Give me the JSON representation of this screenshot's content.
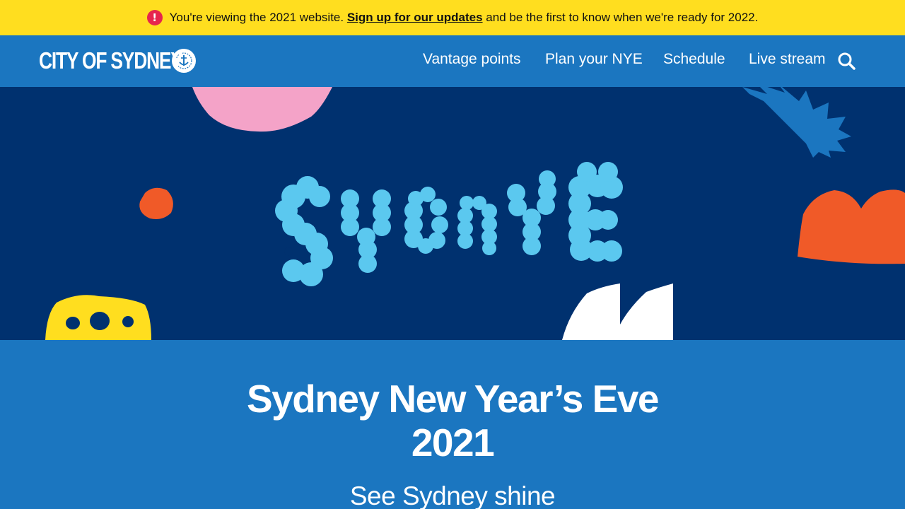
{
  "alert": {
    "icon": "alert-icon",
    "icon_glyph": "!",
    "message_before": "You're viewing the 2021 website.",
    "link_text": "Sign up for our updates",
    "message_after": "and be the first to know when we're ready for 2022."
  },
  "header": {
    "logo_text": "CITY OF SYDNEY",
    "nav": [
      {
        "label": "Vantage points"
      },
      {
        "label": "Plan your NYE"
      },
      {
        "label": "Schedule"
      },
      {
        "label": "Live stream"
      }
    ],
    "search_icon": "search-icon"
  },
  "hero": {
    "wordmark": "SYDNYE"
  },
  "main": {
    "title_line1": "Sydney New Year’s Eve",
    "title_line2": "2021",
    "tagline": "See Sydney shine"
  },
  "colors": {
    "alert_bg": "#ffde1f",
    "brand_blue": "#1b76c0",
    "hero_navy": "#00316f",
    "wordmark_blue": "#5bc8ef",
    "accent_orange": "#f05a28",
    "accent_pink": "#f4a3c8",
    "accent_yellow": "#ffde1f",
    "alert_red": "#e6264d"
  }
}
